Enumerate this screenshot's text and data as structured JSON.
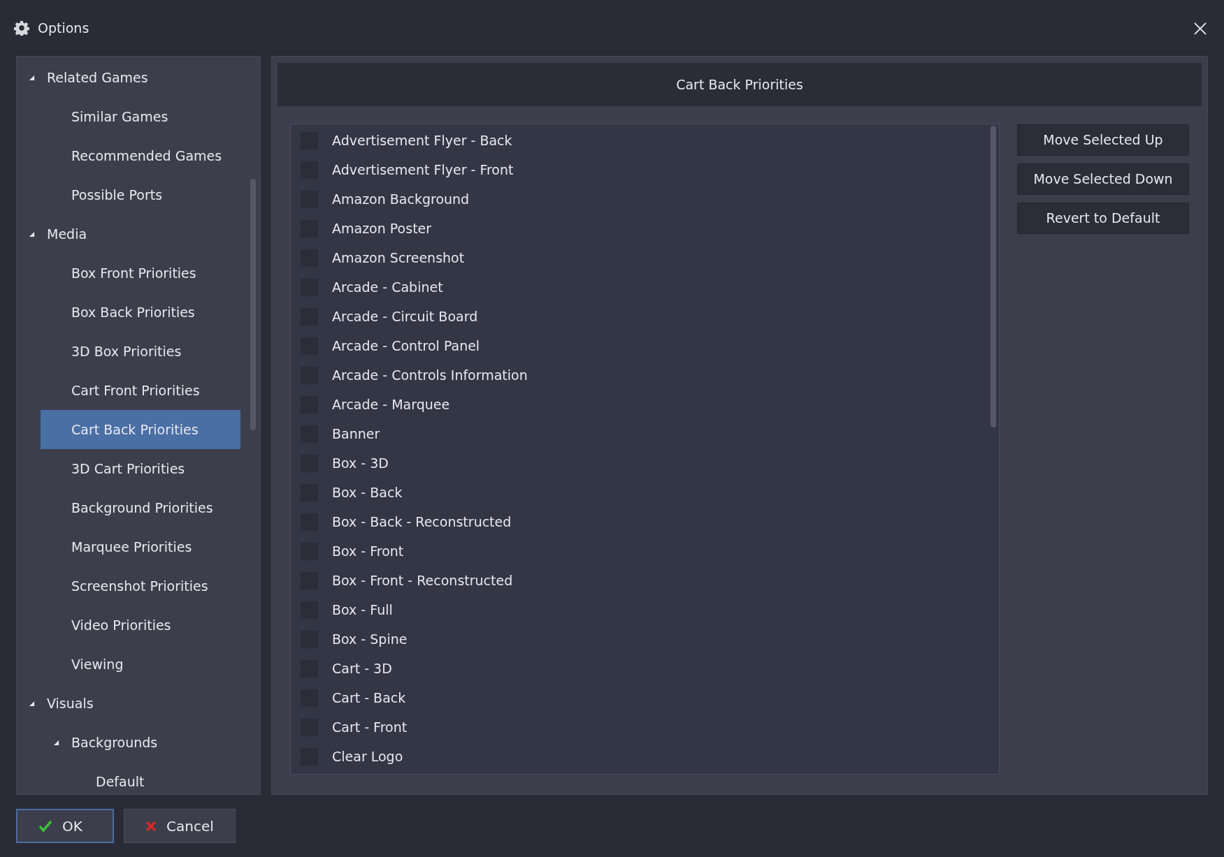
{
  "window": {
    "title": "Options"
  },
  "sidebar": {
    "items": [
      {
        "label": "Related Games",
        "expanded": true,
        "selected": false,
        "children": [
          {
            "label": "Similar Games",
            "selected": false
          },
          {
            "label": "Recommended Games",
            "selected": false
          },
          {
            "label": "Possible Ports",
            "selected": false
          }
        ]
      },
      {
        "label": "Media",
        "expanded": true,
        "selected": false,
        "children": [
          {
            "label": "Box Front Priorities",
            "selected": false
          },
          {
            "label": "Box Back Priorities",
            "selected": false
          },
          {
            "label": "3D Box Priorities",
            "selected": false
          },
          {
            "label": "Cart Front Priorities",
            "selected": false
          },
          {
            "label": "Cart Back Priorities",
            "selected": true
          },
          {
            "label": "3D Cart Priorities",
            "selected": false
          },
          {
            "label": "Background Priorities",
            "selected": false
          },
          {
            "label": "Marquee Priorities",
            "selected": false
          },
          {
            "label": "Screenshot Priorities",
            "selected": false
          },
          {
            "label": "Video Priorities",
            "selected": false
          },
          {
            "label": "Viewing",
            "selected": false
          }
        ]
      },
      {
        "label": "Visuals",
        "expanded": true,
        "selected": false,
        "children": [
          {
            "label": "Backgrounds",
            "expanded": true,
            "selected": false,
            "children": [
              {
                "label": "Default",
                "selected": false
              }
            ]
          }
        ]
      }
    ]
  },
  "panel": {
    "title": "Cart Back Priorities",
    "items": [
      {
        "label": "Advertisement Flyer - Back",
        "checked": false
      },
      {
        "label": "Advertisement Flyer - Front",
        "checked": false
      },
      {
        "label": "Amazon Background",
        "checked": false
      },
      {
        "label": "Amazon Poster",
        "checked": false
      },
      {
        "label": "Amazon Screenshot",
        "checked": false
      },
      {
        "label": "Arcade - Cabinet",
        "checked": false
      },
      {
        "label": "Arcade - Circuit Board",
        "checked": false
      },
      {
        "label": "Arcade - Control Panel",
        "checked": false
      },
      {
        "label": "Arcade - Controls Information",
        "checked": false
      },
      {
        "label": "Arcade - Marquee",
        "checked": false
      },
      {
        "label": "Banner",
        "checked": false
      },
      {
        "label": "Box - 3D",
        "checked": false
      },
      {
        "label": "Box - Back",
        "checked": false
      },
      {
        "label": "Box - Back - Reconstructed",
        "checked": false
      },
      {
        "label": "Box - Front",
        "checked": false
      },
      {
        "label": "Box - Front - Reconstructed",
        "checked": false
      },
      {
        "label": "Box - Full",
        "checked": false
      },
      {
        "label": "Box - Spine",
        "checked": false
      },
      {
        "label": "Cart - 3D",
        "checked": false
      },
      {
        "label": "Cart - Back",
        "checked": false
      },
      {
        "label": "Cart - Front",
        "checked": false
      },
      {
        "label": "Clear Logo",
        "checked": false
      }
    ],
    "buttons": [
      "Move Selected Up",
      "Move Selected Down",
      "Revert to Default"
    ]
  },
  "footer": {
    "buttons": [
      {
        "label": "OK",
        "kind": "ok",
        "default": true
      },
      {
        "label": "Cancel",
        "kind": "cancel",
        "default": false
      }
    ]
  }
}
